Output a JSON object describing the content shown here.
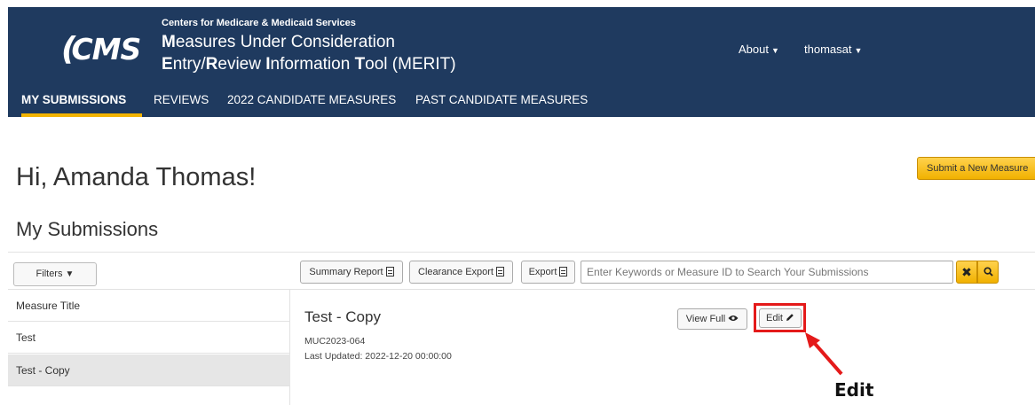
{
  "header": {
    "logo_text": "CMS",
    "org_name": "Centers for Medicare & Medicaid Services",
    "title_line1_prefix": "M",
    "title_line1_rest": "easures Under Consideration",
    "title_line2": [
      "E",
      "ntry/",
      "R",
      "eview ",
      "I",
      "nformation ",
      "T",
      "ool (MERIT)"
    ],
    "about_label": "About",
    "user_label": "thomasat",
    "caret_icon": "caret-down-icon"
  },
  "nav": {
    "tabs": [
      {
        "label": "MY SUBMISSIONS",
        "active": true
      },
      {
        "label": "REVIEWS",
        "active": false
      },
      {
        "label": "2022 CANDIDATE MEASURES",
        "active": false
      },
      {
        "label": "PAST CANDIDATE MEASURES",
        "active": false
      }
    ],
    "active_color": "#f2b300"
  },
  "greeting": "Hi, Amanda Thomas!",
  "submit_button": "Submit a New Measure",
  "section_title": "My Submissions",
  "toolbar": {
    "filters_label": "Filters",
    "summary_report_label": "Summary Report",
    "clearance_export_label": "Clearance Export",
    "export_label": "Export",
    "search_placeholder": "Enter Keywords or Measure ID to Search Your Submissions",
    "clear_symbol": "✖",
    "search_icon": "search-icon"
  },
  "list": {
    "items": [
      {
        "label": "Measure Title",
        "selected": false
      },
      {
        "label": "Test",
        "selected": false
      },
      {
        "label": "Test - Copy",
        "selected": true
      }
    ]
  },
  "detail": {
    "title": "Test - Copy",
    "measure_id": "MUC2023-064",
    "last_updated": "Last Updated: 2022-12-20 00:00:00",
    "view_full_label": "View Full",
    "edit_label": "Edit"
  },
  "annotation": {
    "label": "Edit",
    "color": "#e41a1a"
  },
  "colors": {
    "header_bg": "#1f3a5f",
    "accent_yellow": "#f1b100"
  }
}
